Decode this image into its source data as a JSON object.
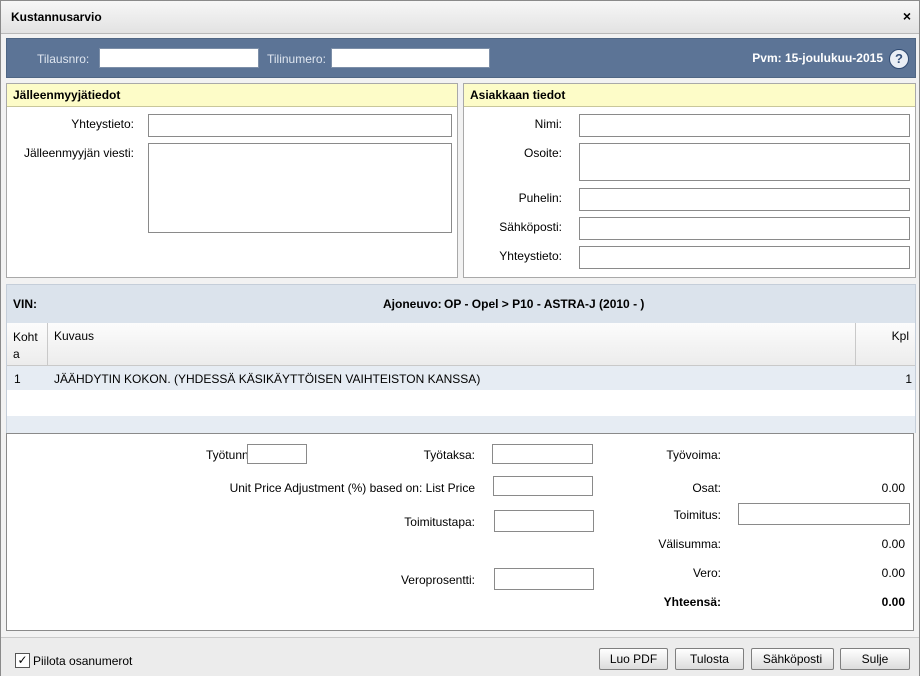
{
  "window": {
    "title": "Kustannusarvio",
    "close_glyph": "×"
  },
  "order_bar": {
    "order_no_label": "Tilausnro:",
    "account_no_label": "Tilinumero:",
    "date_text": "Pvm: 15-joulukuu-2015",
    "help_glyph": "?",
    "order_no_value": "",
    "account_no_value": ""
  },
  "reseller": {
    "title": "Jälleenmyyjätiedot",
    "contact_label": "Yhteystieto:",
    "message_label": "Jälleenmyyjän viesti:"
  },
  "customer": {
    "title": "Asiakkaan tiedot",
    "name_label": "Nimi:",
    "address_label": "Osoite:",
    "phone_label": "Puhelin:",
    "email_label": "Sähköposti:",
    "contact_label": "Yhteystieto:"
  },
  "vehicle": {
    "vin_label": "VIN:",
    "vehicle_label": "Ajoneuvo:",
    "vehicle_value": "OP - Opel > P10 - ASTRA-J (2010 - )"
  },
  "table": {
    "columns": [
      "Koht a",
      "Kuvaus",
      "Kpl"
    ],
    "rows": [
      {
        "item": "1",
        "description": "JÄÄHDYTIN KOKON.  (YHDESSÄ KÄSIKÄYTTÖISEN VAIHTEISTON KANSSA)",
        "qty": "1"
      }
    ]
  },
  "totals": {
    "work_hours_label": "Työtunnit:",
    "work_rate_label": "Työtaksa:",
    "price_adjust_label": "Unit Price Adjustment (%) based on: List Price",
    "delivery_method_label": "Toimitustapa:",
    "tax_percent_label": "Veroprosentti:",
    "labour_label": "Työvoima:",
    "parts_label": "Osat:",
    "parts_value": "0.00",
    "delivery_label": "Toimitus:",
    "subtotal_label": "Välisumma:",
    "subtotal_value": "0.00",
    "tax_label": "Vero:",
    "tax_value": "0.00",
    "total_label": "Yhteensä:",
    "total_value": "0.00"
  },
  "footer": {
    "hide_part_numbers_label": "Piilota osanumerot",
    "hide_part_numbers_checked": true,
    "check_glyph": "✓",
    "pdf_button": "Luo PDF",
    "print_button": "Tulosta",
    "email_button": "Sähköposti",
    "close_button": "Sulje"
  },
  "colors": {
    "order_bar_bg": "#5c7496",
    "section_header_bg": "#fdfcc8",
    "vehicle_bar_bg": "#dbe3ec",
    "row_stripe": "#e6ecf3"
  }
}
